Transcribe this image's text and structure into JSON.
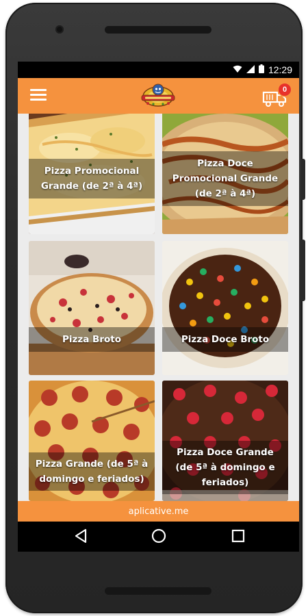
{
  "status_bar": {
    "time": "12:29",
    "icons": [
      "wifi-icon",
      "signal-icon",
      "battery-icon"
    ]
  },
  "app_bar": {
    "menu_icon": "hamburger-menu-icon",
    "logo": "restaurant-logo",
    "cart_icon": "delivery-truck-icon",
    "cart_count": "0"
  },
  "products": [
    {
      "title": "Pizza Promocional\nGrande (de 2ª à 4ª)"
    },
    {
      "title": "Pizza Doce\nPromocional Grande\n(de 2ª à 4ª)"
    },
    {
      "title": "Pizza Broto"
    },
    {
      "title": "Pizza Doce Broto"
    },
    {
      "title": "Pizza Grande (de 5ª à\ndomingo e feriados)"
    },
    {
      "title": "Pizza Doce Grande\n(de 5ª à domingo e\nferiados)"
    }
  ],
  "footer": {
    "text": "aplicative.me"
  },
  "nav_bar": {
    "icons": [
      "back-icon",
      "home-icon",
      "recents-icon"
    ]
  },
  "colors": {
    "accent": "#f5923e",
    "badge": "#e8312a"
  }
}
